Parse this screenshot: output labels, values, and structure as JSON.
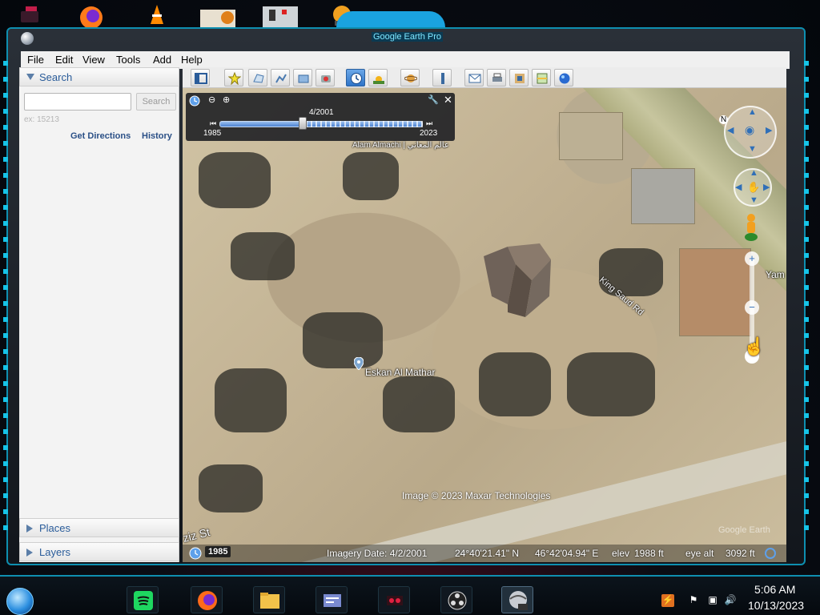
{
  "window": {
    "title": "Google Earth Pro"
  },
  "menu": [
    "File",
    "Edit",
    "View",
    "Tools",
    "Add",
    "Help"
  ],
  "toolbar": {
    "buttons": [
      "sidebar-toggle",
      "placemark",
      "polygon",
      "path",
      "image-overlay",
      "record-tour",
      "historical-imagery",
      "sunlight",
      "planets",
      "ruler",
      "email",
      "print",
      "save-image",
      "view-in-maps",
      "earth"
    ],
    "active": "historical-imagery"
  },
  "search_panel": {
    "header": "Search",
    "input_placeholder": "",
    "button": "Search",
    "example": "ex: 15213",
    "link_directions": "Get Directions",
    "link_history": "History"
  },
  "places_header": "Places",
  "layers_header": "Layers",
  "time_slider": {
    "current_date": "4/2001",
    "start_year": "1985",
    "end_year": "2023",
    "position": 0.41
  },
  "map": {
    "labels": {
      "place": "Eskan Al Mathar",
      "road": "King Saud Rd",
      "partial_right": "Yam",
      "partial_top": "Alam Almachi | عالم المعاني",
      "partial_bottom_left": "ziz St"
    },
    "attribution": "Image © 2023 Maxar Technologies",
    "watermark": "Google Earth"
  },
  "status": {
    "year_badge": "1985",
    "imagery_date": "Imagery Date: 4/2/2001",
    "lat": "24°40'21.41\" N",
    "lon": "46°42'04.94\" E",
    "elev_label": "elev",
    "elev_value": "1988 ft",
    "eye_label": "eye alt",
    "eye_value": "3092 ft"
  },
  "nav": {
    "compass_letter": "N"
  },
  "taskbar": {
    "time": "5:06 AM",
    "date": "10/13/2023"
  },
  "colors": {
    "accent": "#0e8fb0",
    "link": "#2a4f86",
    "toolbar_active": "#2f74c8"
  }
}
